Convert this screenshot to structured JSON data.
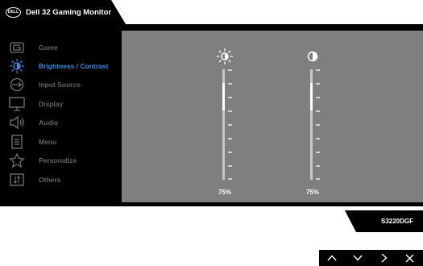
{
  "window": {
    "logo_text": "DELL",
    "title": "Dell 32 Gaming Monitor"
  },
  "menu": {
    "items": [
      {
        "label": "Game",
        "icon": "game-icon",
        "active": false
      },
      {
        "label": "Brightness / Contrast",
        "icon": "brightness-icon",
        "active": true
      },
      {
        "label": "Input Source",
        "icon": "input-source-icon",
        "active": false
      },
      {
        "label": "Display",
        "icon": "display-icon",
        "active": false
      },
      {
        "label": "Audio",
        "icon": "speaker-icon",
        "active": false
      },
      {
        "label": "Menu",
        "icon": "menu-icon",
        "active": false
      },
      {
        "label": "Personalize",
        "icon": "star-icon",
        "active": false
      },
      {
        "label": "Others",
        "icon": "others-icon",
        "active": false
      }
    ]
  },
  "sliders": {
    "brightness": {
      "icon": "sun-icon",
      "value_text": "75%",
      "value": 75
    },
    "contrast": {
      "icon": "contrast-icon",
      "value_text": "75%",
      "value": 75
    }
  },
  "model": {
    "name": "S3220DGF"
  },
  "nav": {
    "buttons": [
      {
        "icon": "up-arrow-icon"
      },
      {
        "icon": "down-arrow-icon"
      },
      {
        "icon": "right-arrow-icon"
      },
      {
        "icon": "close-icon"
      }
    ]
  },
  "colors": {
    "accent": "#2f8de4",
    "inactive_label": "#666666",
    "panel": "#7f7f7f",
    "background": "#000000"
  }
}
